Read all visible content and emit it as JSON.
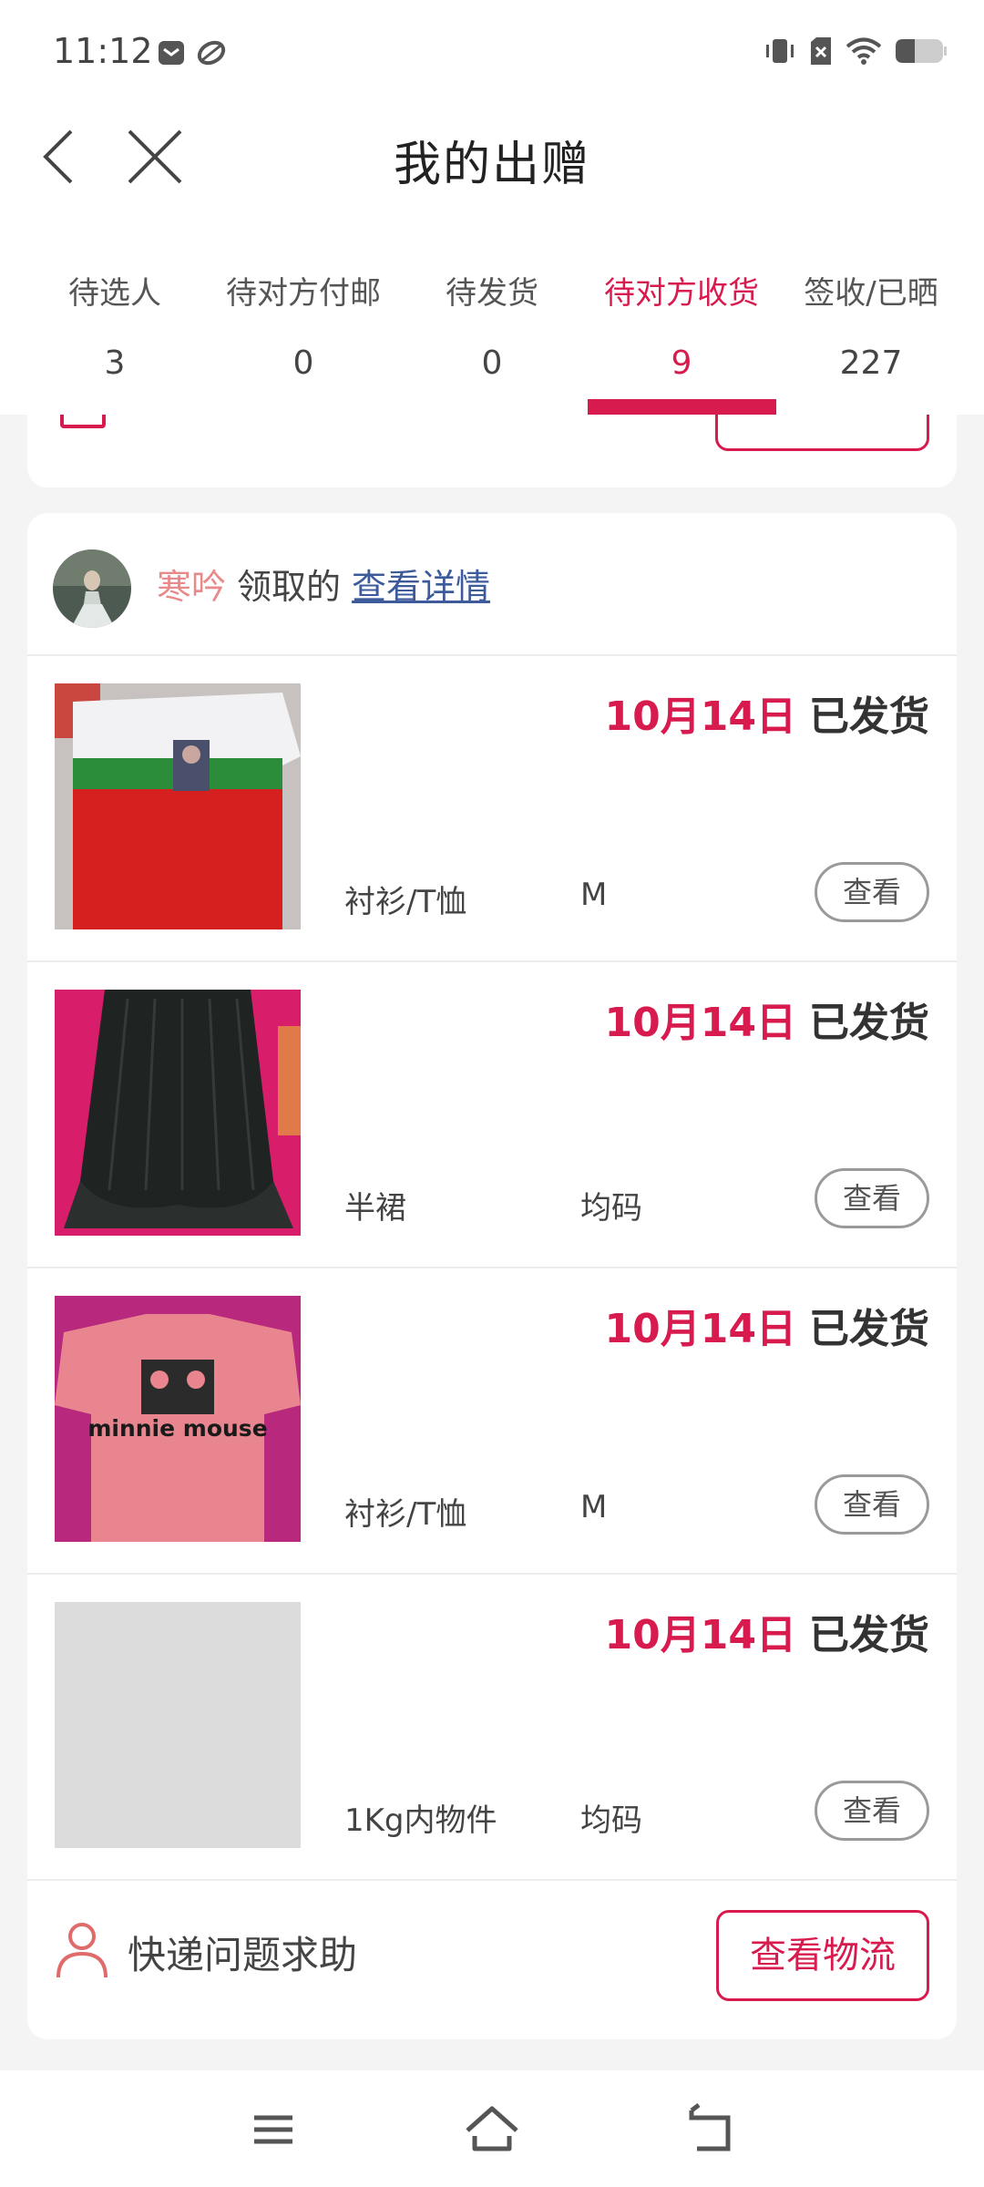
{
  "status_bar": {
    "time": "11:12",
    "icons": [
      "mail-icon",
      "leaf-icon",
      "vibrate-icon",
      "no-sim-icon",
      "wifi-icon",
      "battery-icon"
    ]
  },
  "header": {
    "title": "我的出赠",
    "back_icon": "chevron-left-icon",
    "close_icon": "close-icon"
  },
  "tabs": [
    {
      "label": "待选人",
      "count": "3"
    },
    {
      "label": "待对方付邮",
      "count": "0"
    },
    {
      "label": "待发货",
      "count": "0"
    },
    {
      "label": "待对方收货",
      "count": "9",
      "active": true
    },
    {
      "label": "签收/已晒",
      "count": "227"
    }
  ],
  "accent_color": "#d81b4e",
  "card": {
    "recipient_name": "寒吟",
    "recipient_suffix": "领取的",
    "detail_link": "查看详情",
    "items": [
      {
        "date": "10月14日",
        "status": "已发货",
        "category": "衬衫/T恤",
        "size": "M",
        "view_label": "查看",
        "thumb": "white-green-red-tshirt"
      },
      {
        "date": "10月14日",
        "status": "已发货",
        "category": "半裙",
        "size": "均码",
        "view_label": "查看",
        "thumb": "black-pleated-skirt"
      },
      {
        "date": "10月14日",
        "status": "已发货",
        "category": "衬衫/T恤",
        "size": "M",
        "view_label": "查看",
        "thumb": "pink-minnie-mouse-tshirt",
        "thumb_text": "minnie mouse"
      },
      {
        "date": "10月14日",
        "status": "已发货",
        "category": "1Kg内物件",
        "size": "均码",
        "view_label": "查看",
        "thumb": "placeholder"
      }
    ],
    "help_text": "快递问题求助",
    "logistics_label": "查看物流"
  },
  "nav_bar": {
    "icons": [
      "menu-icon",
      "home-icon",
      "back-icon"
    ]
  }
}
